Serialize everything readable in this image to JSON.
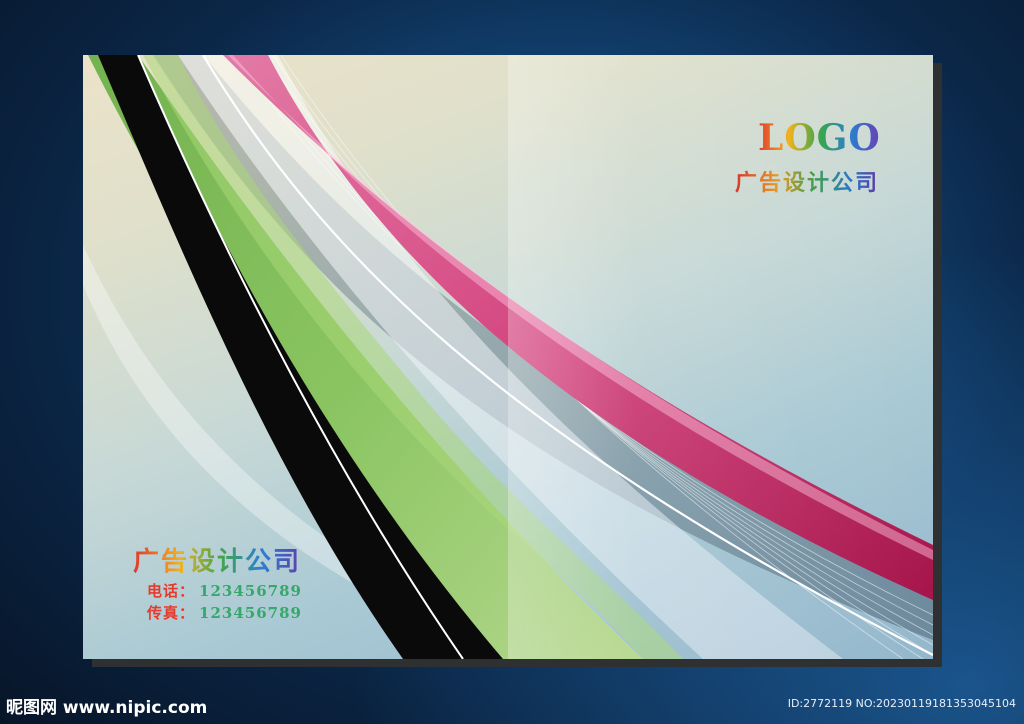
{
  "cover": {
    "logo_text": "LOGO",
    "company_name_top": "广告设计公司",
    "company_name_bottom": "广告设计公司",
    "phone_label": "电话：",
    "phone_value": "123456789",
    "fax_label": "传真：",
    "fax_value": "123456789"
  },
  "watermark": {
    "site": "昵图网 www.nipic.com",
    "id_text": "ID:2772119 NO:20230119181353045104"
  },
  "colors": {
    "background": "#0b2748",
    "ribbon_pink": "#d43a78",
    "ribbon_green": "#7cbf55",
    "ribbon_black": "#0a0a0a"
  }
}
